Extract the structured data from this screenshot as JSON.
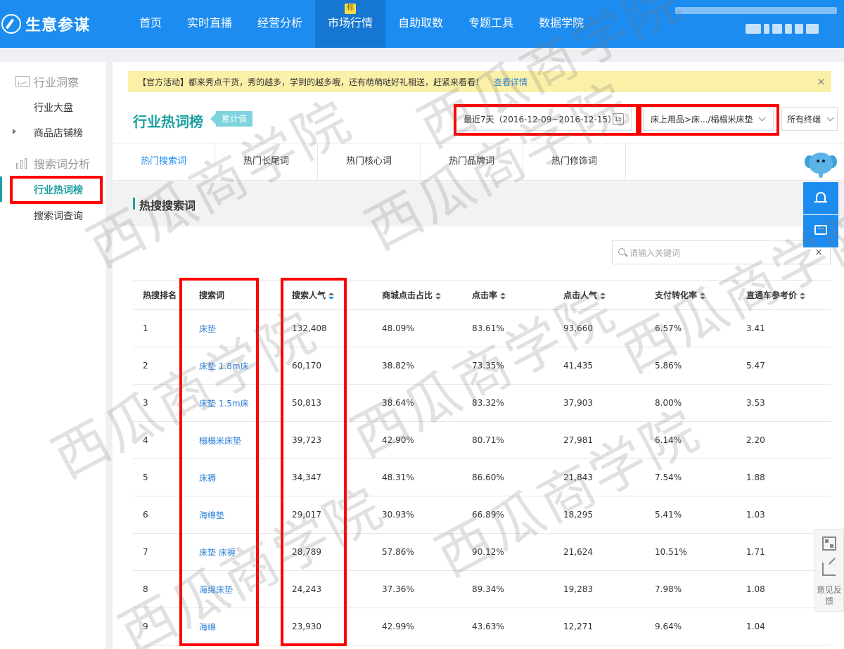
{
  "app": {
    "logo_text": "生意参谋"
  },
  "nav": {
    "items": [
      {
        "label": "首页"
      },
      {
        "label": "实时直播"
      },
      {
        "label": "经营分析"
      },
      {
        "label": "市场行情",
        "badge": "标"
      },
      {
        "label": "自助取数"
      },
      {
        "label": "专题工具"
      },
      {
        "label": "数据学院"
      }
    ]
  },
  "sidebar": {
    "group1": "行业洞察",
    "item1": "行业大盘",
    "item2": "商品店铺榜",
    "group2": "搜索词分析",
    "item3": "行业热词榜",
    "item4": "搜索词查询"
  },
  "notice": {
    "text": "【官方活动】都来秀点干货，秀的越多，学到的越多哦，还有萌萌哒好礼相送，赶紧来看看！",
    "link": "查看详情",
    "close": "×"
  },
  "page": {
    "title": "行业热词榜",
    "tag": "累计值",
    "date_range": "最近7天（2016-12-09~2016-12-15）",
    "calendar_day": "15",
    "category": "床上用品>床.../榻榻米床垫",
    "terminal": "所有终端"
  },
  "tabs": [
    "热门搜索词",
    "热门长尾词",
    "热门核心词",
    "热门品牌词",
    "热门修饰词"
  ],
  "section": {
    "title": "热搜搜索词"
  },
  "search": {
    "placeholder": "请输入关键词",
    "clear": "×"
  },
  "table": {
    "headers": [
      "热搜排名",
      "搜索词",
      "搜索人气",
      "商城点击占比",
      "点击率",
      "点击人气",
      "支付转化率",
      "直通车参考价"
    ],
    "rows": [
      [
        "1",
        "床垫",
        "132,408",
        "48.09%",
        "83.61%",
        "93,660",
        "6.57%",
        "3.41"
      ],
      [
        "2",
        "床垫 1.8m床",
        "60,170",
        "38.82%",
        "73.35%",
        "41,435",
        "5.86%",
        "5.47"
      ],
      [
        "3",
        "床垫 1.5m床",
        "50,813",
        "38.64%",
        "83.32%",
        "37,903",
        "8.00%",
        "3.53"
      ],
      [
        "4",
        "榻榻米床垫",
        "39,723",
        "42.90%",
        "80.71%",
        "27,981",
        "6.14%",
        "2.20"
      ],
      [
        "5",
        "床褥",
        "34,347",
        "48.31%",
        "86.60%",
        "21,843",
        "7.54%",
        "1.88"
      ],
      [
        "6",
        "海绵垫",
        "29,017",
        "30.93%",
        "66.89%",
        "18,295",
        "5.41%",
        "1.03"
      ],
      [
        "7",
        "床垫 床褥",
        "28,789",
        "57.86%",
        "90.12%",
        "21,624",
        "10.51%",
        "1.71"
      ],
      [
        "8",
        "海绵床垫",
        "24,243",
        "37.36%",
        "89.34%",
        "19,283",
        "7.98%",
        "1.08"
      ],
      [
        "9",
        "海绵",
        "23,930",
        "42.99%",
        "43.63%",
        "12,271",
        "9.64%",
        "1.04"
      ]
    ]
  },
  "tools": {
    "feedback": "意见反馈"
  },
  "watermark": "西瓜商学院",
  "colors": {
    "nav_bg": "#1c8cf0",
    "accent": "#1ea0a0",
    "link": "#2b7fd6",
    "highlight": "#ff0000",
    "notice_bg": "#fbf0a8"
  }
}
